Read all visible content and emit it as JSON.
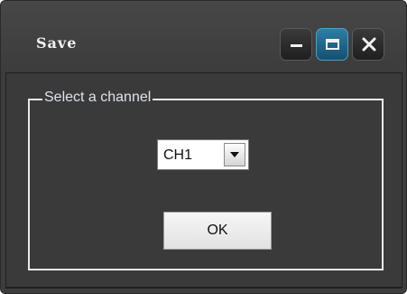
{
  "window": {
    "title": "Save",
    "controls": {
      "minimize_icon": "minimize-icon",
      "maximize_icon": "maximize-icon",
      "close_icon": "close-icon"
    }
  },
  "dialog": {
    "group_label": "Select a channel",
    "channel_select": {
      "selected_value": "CH1"
    },
    "ok_label": "OK"
  },
  "colors": {
    "window_background": "#3d3d3d",
    "active_control": "#1f6b91",
    "groupbox_border": "#e8e8e8"
  }
}
